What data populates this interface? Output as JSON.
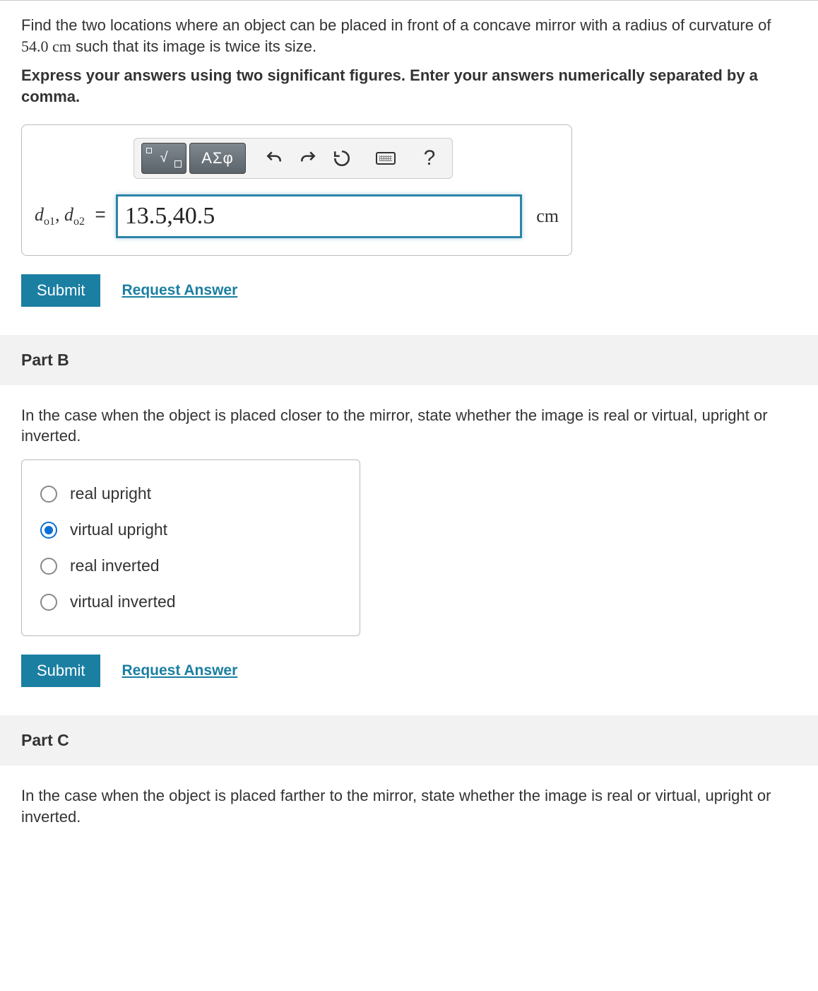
{
  "partA": {
    "prompt_pre": "Find the two locations where an object can be placed in front of a concave mirror with a radius of curvature of ",
    "prompt_val": "54.0 cm",
    "prompt_post": " such that its image is twice its size.",
    "instruction": "Express your answers using two significant figures. Enter your answers numerically separated by a comma.",
    "toolbar": {
      "greek_label": "ΑΣφ",
      "help_label": "?"
    },
    "var_label_html": "d_o1, d_o2",
    "equals": "=",
    "input_value": "13.5,40.5",
    "unit": "cm",
    "submit_label": "Submit",
    "request_label": "Request Answer"
  },
  "partB": {
    "header": "Part B",
    "prompt": "In the case when the object is placed closer to the mirror, state whether the image is real or virtual, upright or inverted.",
    "options": [
      {
        "label": "real upright",
        "selected": false
      },
      {
        "label": "virtual upright",
        "selected": true
      },
      {
        "label": "real inverted",
        "selected": false
      },
      {
        "label": "virtual inverted",
        "selected": false
      }
    ],
    "submit_label": "Submit",
    "request_label": "Request Answer"
  },
  "partC": {
    "header": "Part C",
    "prompt": "In the case when the object is placed farther to the mirror, state whether the image is real or virtual, upright or inverted."
  }
}
